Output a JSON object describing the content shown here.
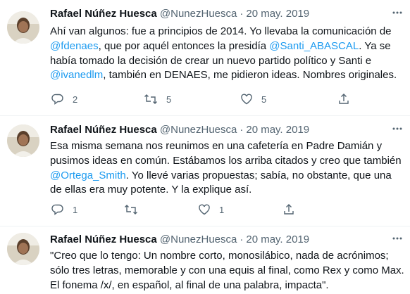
{
  "tweets": [
    {
      "name": "Rafael Núñez Huesca",
      "handle": "@NunezHuesca",
      "separator": "·",
      "date": "20 may. 2019",
      "body": [
        {
          "t": "Ahí van algunos: fue a principios de 2014. Yo llevaba la comunicación de "
        },
        {
          "t": "@fdenaes",
          "link": true
        },
        {
          "t": ", que por aquél entonces la presidía "
        },
        {
          "t": "@Santi_ABASCAL",
          "link": true
        },
        {
          "t": ". Ya se había tomado la decisión de crear un nuevo partido político y Santi e "
        },
        {
          "t": "@ivanedlm",
          "link": true
        },
        {
          "t": ", también en DENAES, me pidieron ideas. Nombres originales."
        }
      ],
      "replies": "2",
      "retweets": "5",
      "likes": "5"
    },
    {
      "name": "Rafael Núñez Huesca",
      "handle": "@NunezHuesca",
      "separator": "·",
      "date": "20 may. 2019",
      "body": [
        {
          "t": "Esa misma semana nos reunimos en una cafetería en Padre Damián y pusimos ideas en común. Estábamos los arriba citados y creo que también "
        },
        {
          "t": "@Ortega_Smith",
          "link": true
        },
        {
          "t": ". Yo llevé varias propuestas; sabía, no obstante, que una de ellas era muy potente. Y la explique así."
        }
      ],
      "replies": "1",
      "retweets": "",
      "likes": "1"
    },
    {
      "name": "Rafael Núñez Huesca",
      "handle": "@NunezHuesca",
      "separator": "·",
      "date": "20 may. 2019",
      "body": [
        {
          "t": "\"Creo que lo tengo: Un nombre corto, monosilábico, nada de acrónimos; sólo tres letras, memorable y con una equis al final, como Rex y como Max. El fonema /x/, en español, al final de una palabra, impacta\"."
        }
      ]
    }
  ],
  "colors": {
    "link": "#1d9bf0",
    "muted": "#536471",
    "text": "#0f1419",
    "separator": "#eff3f4"
  },
  "icons": {
    "reply": "reply-icon",
    "retweet": "retweet-icon",
    "like": "heart-icon",
    "share": "share-icon",
    "more": "more-icon"
  }
}
